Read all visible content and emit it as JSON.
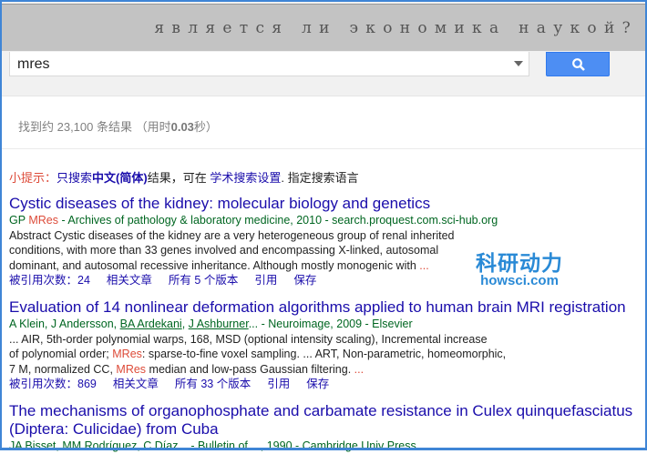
{
  "banner": {
    "text": "является ли экономика наукой?"
  },
  "search": {
    "query": "mres",
    "button_icon": "search-icon"
  },
  "stats": {
    "prefix": "找到约 23,100 条结果 （用时",
    "time": "0.03",
    "suffix": "秒）"
  },
  "tip": {
    "label": "小提示：",
    "p1": "只搜索",
    "lang": "中文(简体)",
    "p2": "结果，可在 ",
    "settings_link": "学术搜索设置",
    "p3": ". 指定搜索语言"
  },
  "watermark": {
    "cn": "科研动力",
    "en": "howsci.com"
  },
  "results": [
    {
      "title": "Cystic diseases of the kidney: molecular biology and genetics",
      "authors_pre": "GP ",
      "authors_hl": "MRes",
      "meta": " - Archives of pathology & laboratory medicine, 2010 - search.proquest.com.sci-hub.org",
      "snippet": [
        "Abstract Cystic diseases of the kidney are a very heterogeneous group of renal inherited",
        "conditions, with more than 33 genes involved and encompassing X-linked, autosomal",
        "dominant, and autosomal recessive inheritance. Although mostly monogenic with "
      ],
      "ellipsis": "...",
      "cited": "被引用次数：24",
      "related": "相关文章",
      "versions": "所有 5 个版本",
      "cite": "引用",
      "save": "保存"
    },
    {
      "title": "Evaluation of 14 nonlinear deformation algorithms applied to human brain MRI registration",
      "authors_a": "A Klein, J Andersson, ",
      "author_link1": "BA Ardekani",
      "sep": ", ",
      "author_link2": "J Ashburner",
      "meta": "... - Neuroimage, 2009 - Elsevier",
      "snip1": "... AIR, 5th-order polynomial warps, 168, MSD (optional intensity scaling), Incremental increase",
      "snip2a": "of polynomial order; ",
      "hl": "MRes",
      "snip2b": ": sparse-to-fine voxel sampling. ... ART, Non-parametric, homeomorphic,",
      "snip3a": "7 M, normalized CC, ",
      "snip3b": " median and low-pass Gaussian filtering. ",
      "ellipsis": "...",
      "cited": "被引用次数：869",
      "related": "相关文章",
      "versions": "所有 33 个版本",
      "cite": "引用",
      "save": "保存"
    },
    {
      "title": "The mechanisms of organophosphate and carbamate resistance in Culex quinquefasciatus (Diptera: Culicidae) from Cuba",
      "meta": "JA Bisset, MM Rodríguez, C Díaz... - Bulletin of ..., 1990 - Cambridge Univ Press"
    }
  ]
}
